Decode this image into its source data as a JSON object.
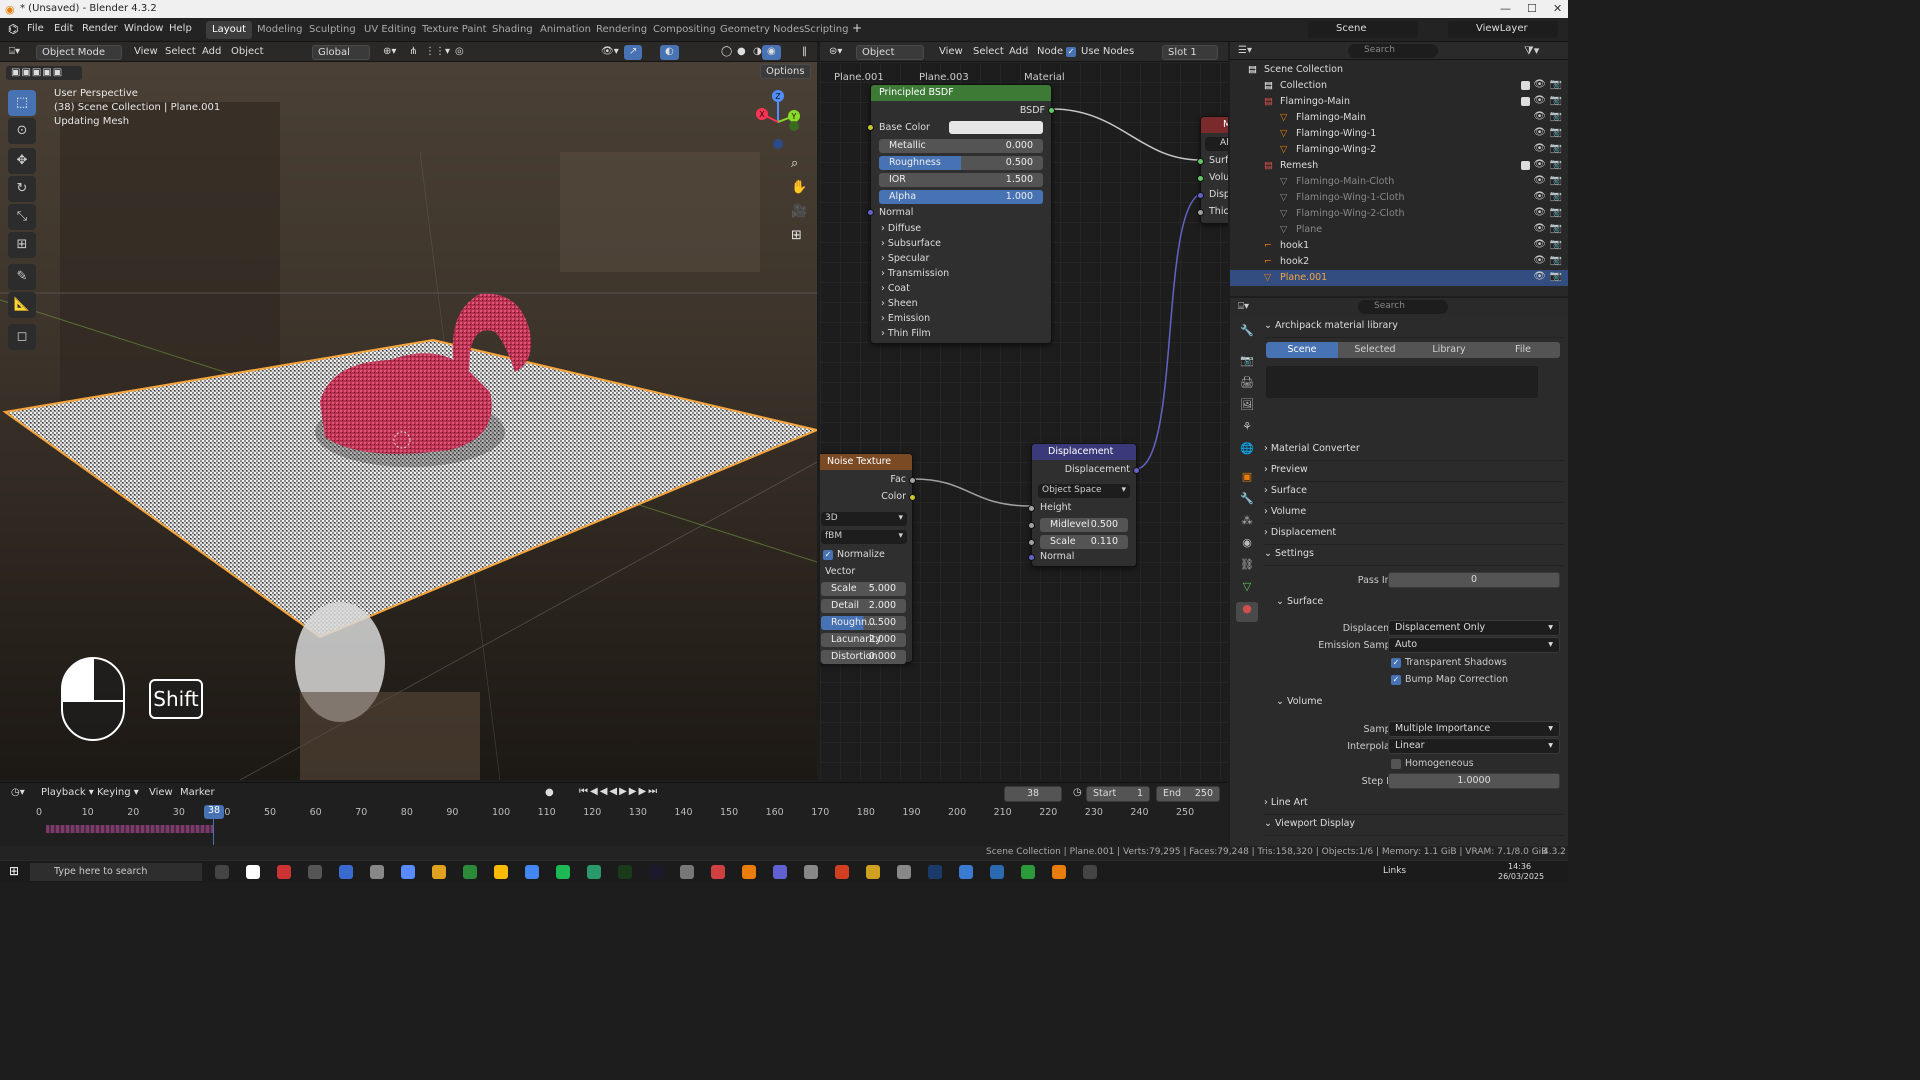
{
  "window": {
    "title": "* (Unsaved) - Blender 4.3.2"
  },
  "menu": {
    "items": [
      "File",
      "Edit",
      "Render",
      "Window",
      "Help"
    ],
    "workspaces": [
      "Layout",
      "Modeling",
      "Sculpting",
      "UV Editing",
      "Texture Paint",
      "Shading",
      "Animation",
      "Rendering",
      "Compositing",
      "Geometry Nodes",
      "Scripting"
    ],
    "active_workspace": "Layout",
    "scene": "Scene",
    "view_layer": "ViewLayer"
  },
  "viewport": {
    "mode": "Object Mode",
    "menus": [
      "View",
      "Select",
      "Add",
      "Object"
    ],
    "transform": "Global",
    "options": "Options",
    "overlay_lines": [
      "User Perspective",
      "(38) Scene Collection | Plane.001",
      "Updating Mesh"
    ],
    "key_hint": "Shift",
    "gizmo": {
      "x": "X",
      "y": "Y",
      "z": "Z"
    }
  },
  "node_editor": {
    "object_type": "Object",
    "menus": [
      "View",
      "Select",
      "Add",
      "Node"
    ],
    "use_nodes": "Use Nodes",
    "slot": "Slot 1",
    "breadcrumb": [
      "Plane.001",
      "Plane.003",
      "Material"
    ],
    "bsdf": {
      "title": "Principled BSDF",
      "output": "BSDF",
      "base_color": "Base Color",
      "fields": [
        {
          "label": "Metallic",
          "value": "0.000"
        },
        {
          "label": "Roughness",
          "value": "0.500"
        },
        {
          "label": "IOR",
          "value": "1.500"
        },
        {
          "label": "Alpha",
          "value": "1.000"
        }
      ],
      "normal": "Normal",
      "panels": [
        "Diffuse",
        "Subsurface",
        "Specular",
        "Transmission",
        "Coat",
        "Sheen",
        "Emission",
        "Thin Film"
      ]
    },
    "output_node": {
      "title": "M",
      "target": "All",
      "sockets": [
        "Surfa",
        "Volu",
        "Displ",
        "Thick"
      ]
    },
    "noise": {
      "title": "Noise Texture",
      "outputs": [
        "Fac",
        "Color"
      ],
      "dim": "3D",
      "type": "fBM",
      "normalize": "Normalize",
      "vector": "Vector",
      "fields": [
        {
          "label": "Scale",
          "value": "5.000"
        },
        {
          "label": "Detail",
          "value": "2.000"
        },
        {
          "label": "Roughn...",
          "value": "0.500"
        },
        {
          "label": "Lacunarity",
          "value": "2.000"
        },
        {
          "label": "Distortion",
          "value": "0.000"
        }
      ]
    },
    "displacement": {
      "title": "Displacement",
      "output": "Displacement",
      "space": "Object Space",
      "height": "Height",
      "fields": [
        {
          "label": "Midlevel",
          "value": "0.500"
        },
        {
          "label": "Scale",
          "value": "0.110"
        }
      ],
      "normal": "Normal"
    }
  },
  "outliner": {
    "search": "Search",
    "rows": [
      {
        "label": "Scene Collection",
        "indent": 0
      },
      {
        "label": "Collection",
        "indent": 1
      },
      {
        "label": "Flamingo-Main",
        "indent": 1
      },
      {
        "label": "Flamingo-Main",
        "indent": 2
      },
      {
        "label": "Flamingo-Wing-1",
        "indent": 2
      },
      {
        "label": "Flamingo-Wing-2",
        "indent": 2
      },
      {
        "label": "Remesh",
        "indent": 1
      },
      {
        "label": "Flamingo-Main-Cloth",
        "indent": 2
      },
      {
        "label": "Flamingo-Wing-1-Cloth",
        "indent": 2
      },
      {
        "label": "Flamingo-Wing-2-Cloth",
        "indent": 2
      },
      {
        "label": "Plane",
        "indent": 2
      },
      {
        "label": "hook1",
        "indent": 1
      },
      {
        "label": "hook2",
        "indent": 1
      },
      {
        "label": "Plane.001",
        "indent": 1
      }
    ]
  },
  "properties": {
    "search": "Search",
    "archipack": "Archipack material library",
    "tabs": [
      "Scene",
      "Selected",
      "Library",
      "File"
    ],
    "sections": [
      "Material Converter",
      "Preview",
      "Surface",
      "Volume",
      "Displacement",
      "Settings"
    ],
    "pass_index_label": "Pass Index",
    "pass_index": "0",
    "surface_header": "Surface",
    "displacement_label": "Displacement",
    "displacement_value": "Displacement Only",
    "emission_label": "Emission Sampling",
    "emission_value": "Auto",
    "transparent_shadows": "Transparent Shadows",
    "bump_map": "Bump Map Correction",
    "volume_header": "Volume",
    "sampling_label": "Sampling",
    "sampling_value": "Multiple Importance",
    "interp_label": "Interpolation",
    "interp_value": "Linear",
    "homogeneous": "Homogeneous",
    "step_label": "Step Rate",
    "step_value": "1.0000",
    "line_art": "Line Art",
    "viewport_display": "Viewport Display"
  },
  "timeline": {
    "menus": [
      "Playback",
      "Keying",
      "View",
      "Marker"
    ],
    "current": "38",
    "start_label": "Start",
    "start": "1",
    "end_label": "End",
    "end": "250",
    "ticks": [
      "0",
      "10",
      "20",
      "30",
      "40",
      "50",
      "60",
      "70",
      "80",
      "90",
      "100",
      "110",
      "120",
      "130",
      "140",
      "150",
      "160",
      "170",
      "180",
      "190",
      "200",
      "210",
      "220",
      "230",
      "240",
      "250"
    ]
  },
  "status": {
    "text": "Scene Collection | Plane.001 | Verts:79,295 | Faces:79,248 | Tris:158,320 | Objects:1/6 | Memory: 1.1 GiB | VRAM: 7.1/8.0 GiB",
    "version": "4.3.2"
  },
  "taskbar": {
    "search": "Type here to search",
    "links": "Links",
    "time": "14:36",
    "date": "26/03/2025"
  }
}
